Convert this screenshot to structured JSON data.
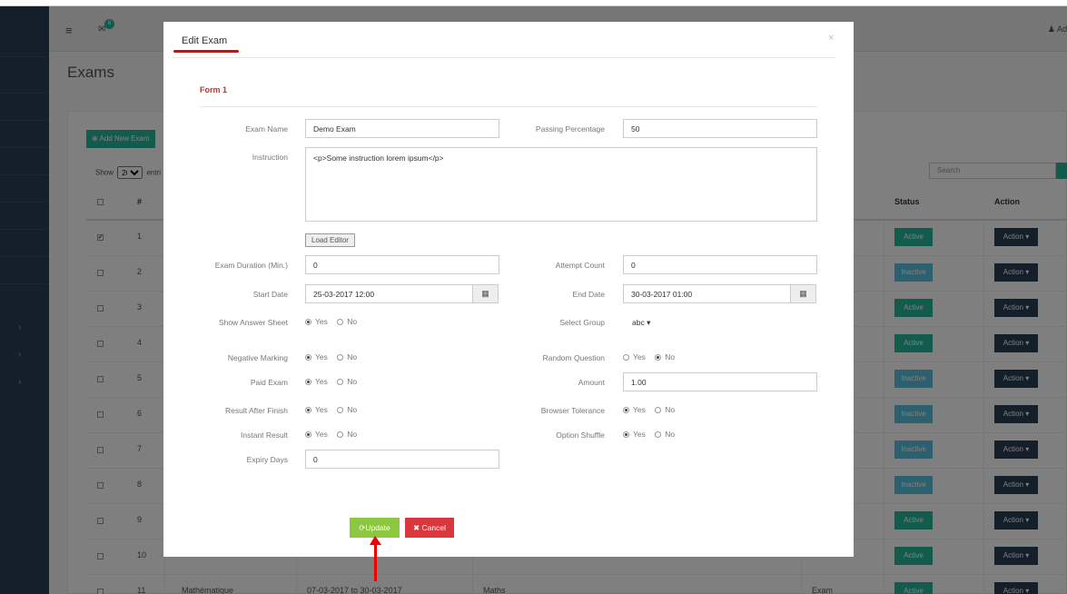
{
  "app": {
    "page_title": "Exams",
    "mail_badge": "8",
    "user_label": "Ad",
    "add_button": "Add New Exam",
    "show_label": "Show",
    "page_size": "20",
    "entries_label": "entri",
    "search_placeholder": "Search",
    "headers": {
      "num": "#",
      "status": "Status",
      "action": "Action"
    },
    "rows": [
      {
        "num": "1",
        "status": "Active",
        "checked": true
      },
      {
        "num": "2",
        "status": "Inactive"
      },
      {
        "num": "3",
        "status": "Active"
      },
      {
        "num": "4",
        "status": "Active"
      },
      {
        "num": "5",
        "status": "Inactive"
      },
      {
        "num": "6",
        "status": "Inactive"
      },
      {
        "num": "7",
        "status": "Inactive"
      },
      {
        "num": "8",
        "status": "Inactive"
      },
      {
        "num": "9",
        "status": "Active"
      },
      {
        "num": "10",
        "status": "Active"
      },
      {
        "num": "11",
        "name": "Mathématique",
        "dates": "07-03-2017 to 30-03-2017",
        "subject": "Maths",
        "type": "Exam",
        "status": "Active"
      }
    ],
    "action_label": "Action"
  },
  "modal": {
    "title": "Edit Exam",
    "close": "×",
    "form_title": "Form 1",
    "labels": {
      "exam_name": "Exam Name",
      "passing_percentage": "Passing Percentage",
      "instruction": "Instruction",
      "load_editor": "Load Editor",
      "exam_duration": "Exam Duration (Min.)",
      "attempt_count": "Attempt Count",
      "start_date": "Start Date",
      "end_date": "End Date",
      "show_answer_sheet": "Show Answer Sheet",
      "select_group": "Select Group",
      "negative_marking": "Negative Marking",
      "random_question": "Random Question",
      "paid_exam": "Paid Exam",
      "amount": "Amount",
      "result_after_finish": "Result After Finish",
      "browser_tolerance": "Browser Tolerance",
      "instant_result": "Instant Result",
      "option_shuffle": "Option Shuffle",
      "expiry_days": "Expiry Days",
      "yes": "Yes",
      "no": "No"
    },
    "values": {
      "exam_name": "Demo Exam",
      "passing_percentage": "50",
      "instruction": "<p>Some instruction lorem ipsum</p>",
      "exam_duration": "0",
      "attempt_count": "0",
      "start_date": "25-03-2017 12:00",
      "end_date": "30-03-2017 01:00",
      "select_group": "abc",
      "amount": "1.00",
      "expiry_days": "0"
    },
    "radios": {
      "show_answer_sheet": "yes",
      "negative_marking": "yes",
      "random_question": "no",
      "paid_exam": "yes",
      "result_after_finish": "yes",
      "browser_tolerance": "yes",
      "instant_result": "yes",
      "option_shuffle": "yes"
    },
    "buttons": {
      "update": "Update",
      "cancel": "Cancel"
    }
  },
  "icons": {
    "menu": "hamburger-icon",
    "mail": "envelope-icon",
    "user": "user-icon",
    "calendar": "calendar-icon",
    "update": "refresh-icon",
    "cancel": "times-icon"
  },
  "colors": {
    "active": "#26b99a",
    "inactive": "#5bc0de",
    "update": "#8dc63f",
    "cancel": "#d9363e",
    "annotation": "#ee0000"
  }
}
